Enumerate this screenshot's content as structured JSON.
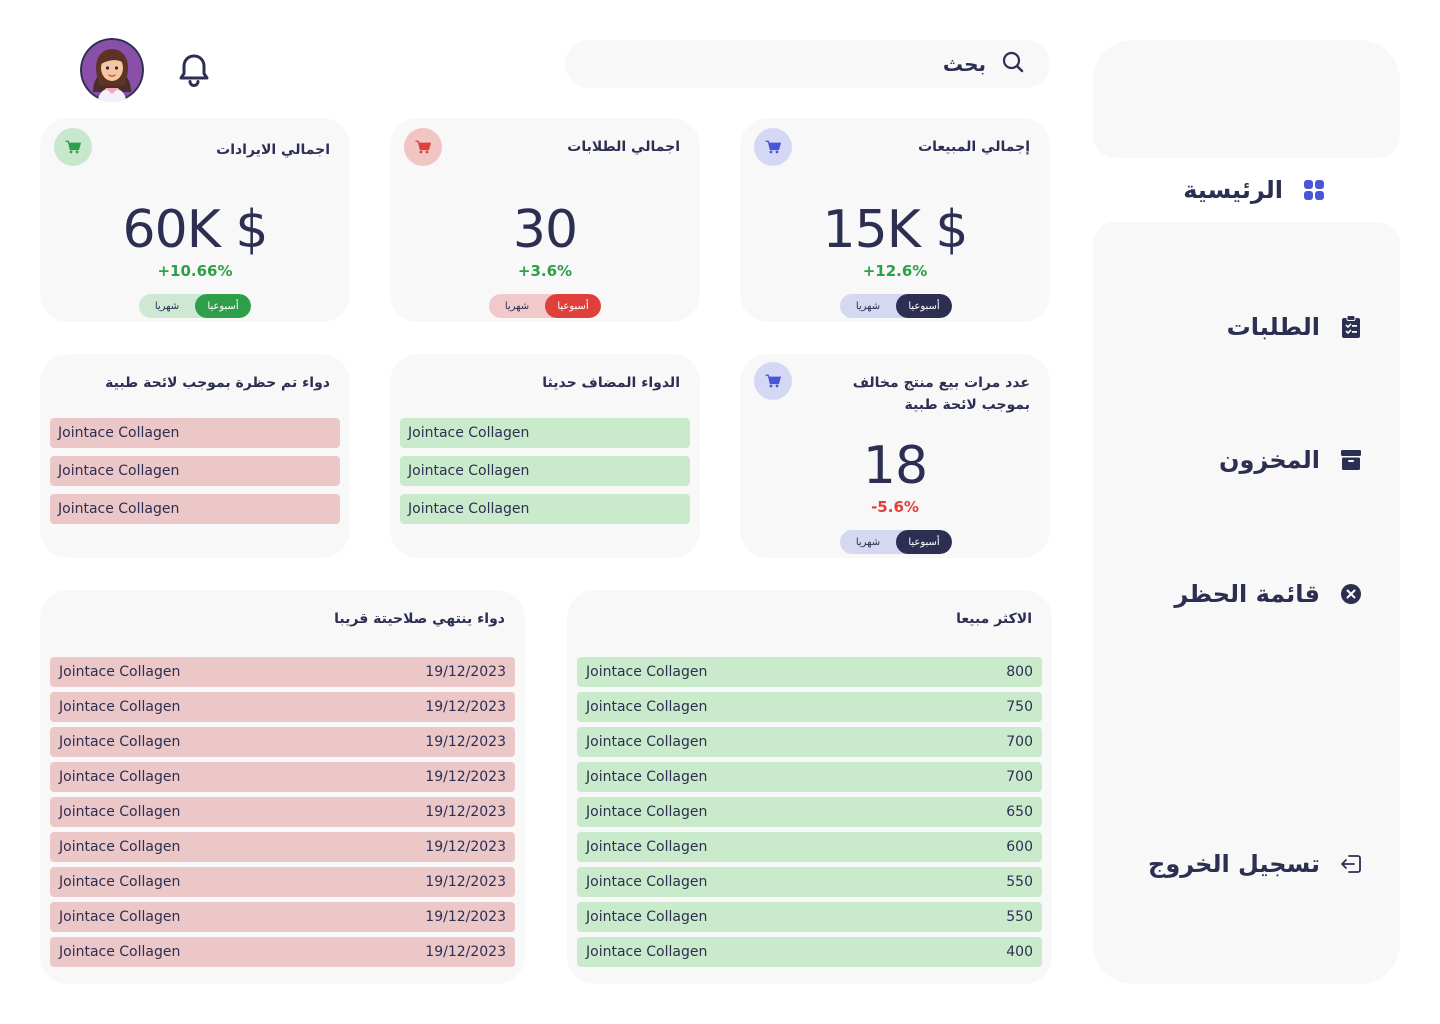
{
  "colors": {
    "panel": "#f8f8f8",
    "text": "#2d2f52",
    "accent_blue": "#4a56d8",
    "positive": "#2e9e4a",
    "negative": "#e0403c",
    "expired_row": "#ebc7c8",
    "top_row": "#caebcb"
  },
  "sidebar": {
    "items": [
      {
        "label": "الرئيسية",
        "icon": "grid-icon",
        "active": true
      },
      {
        "label": "الطلبات",
        "icon": "clipboard-icon",
        "active": false
      },
      {
        "label": "المخزون",
        "icon": "archive-icon",
        "active": false
      },
      {
        "label": "قائمة الحظر",
        "icon": "x-circle-icon",
        "active": false
      },
      {
        "label": "تسجيل الخروج",
        "icon": "logout-icon",
        "active": false
      }
    ]
  },
  "header": {
    "search_placeholder": "بحث",
    "search_icon": "search-icon",
    "bell_icon": "bell-icon"
  },
  "stats": {
    "sales": {
      "title": "إجمالي المبيعات",
      "value": "15K $",
      "change": "+12.6%",
      "toggle": {
        "weekly": "أسبوعيا",
        "monthly": "شهريا"
      }
    },
    "orders": {
      "title": "اجمالي الطلابات",
      "value": "30",
      "change": "+3.6%",
      "toggle": {
        "weekly": "أسبوعيا",
        "monthly": "شهريا"
      }
    },
    "revenue": {
      "title": "اجمالي الايرادات",
      "value": "60K $",
      "change": "+10.66%",
      "toggle": {
        "weekly": "أسبوعيا",
        "monthly": "شهريا"
      }
    },
    "violations": {
      "title": "عدد مرات بيع منتج مخالف بموجب لائحة طبية",
      "value": "18",
      "change": "-5.6%",
      "toggle": {
        "weekly": "أسبوعيا",
        "monthly": "شهريا"
      }
    }
  },
  "new_medicine": {
    "title": "الدواء المضاف حديثا",
    "items": [
      "Jointace Collagen",
      "Jointace Collagen",
      "Jointace Collagen"
    ]
  },
  "banned_medicine": {
    "title": "دواء تم حظرة بموجب لائحة طبية",
    "items": [
      "Jointace Collagen",
      "Jointace Collagen",
      "Jointace Collagen"
    ]
  },
  "best_sellers": {
    "title": "الاكثر مبيعا",
    "rows": [
      {
        "name": "Jointace Collagen",
        "value": "800"
      },
      {
        "name": "Jointace Collagen",
        "value": "750"
      },
      {
        "name": "Jointace Collagen",
        "value": "700"
      },
      {
        "name": "Jointace Collagen",
        "value": "700"
      },
      {
        "name": "Jointace Collagen",
        "value": "650"
      },
      {
        "name": "Jointace Collagen",
        "value": "600"
      },
      {
        "name": "Jointace Collagen",
        "value": "550"
      },
      {
        "name": "Jointace Collagen",
        "value": "550"
      },
      {
        "name": "Jointace Collagen",
        "value": "400"
      }
    ]
  },
  "expiring": {
    "title": "دواء ينتهي صلاحيتة قريبا",
    "rows": [
      {
        "name": "Jointace Collagen",
        "date": "19/12/2023"
      },
      {
        "name": "Jointace Collagen",
        "date": "19/12/2023"
      },
      {
        "name": "Jointace Collagen",
        "date": "19/12/2023"
      },
      {
        "name": "Jointace Collagen",
        "date": "19/12/2023"
      },
      {
        "name": "Jointace Collagen",
        "date": "19/12/2023"
      },
      {
        "name": "Jointace Collagen",
        "date": "19/12/2023"
      },
      {
        "name": "Jointace Collagen",
        "date": "19/12/2023"
      },
      {
        "name": "Jointace Collagen",
        "date": "19/12/2023"
      },
      {
        "name": "Jointace Collagen",
        "date": "19/12/2023"
      }
    ]
  }
}
